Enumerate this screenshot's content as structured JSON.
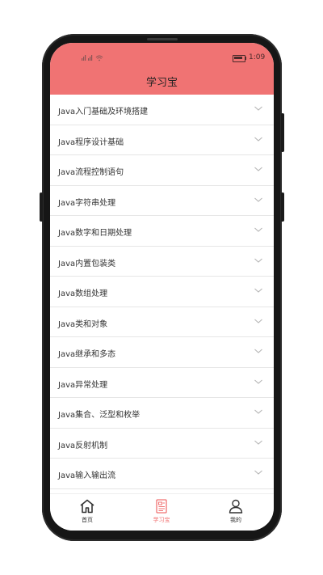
{
  "status_bar": {
    "signal_text": "ᵢᵢ ᵢᵢ",
    "time": "1:09"
  },
  "header": {
    "title": "学习宝",
    "background_color": "#f07373"
  },
  "list": {
    "items": [
      {
        "label": "Java入门基础及环境搭建"
      },
      {
        "label": "Java程序设计基础"
      },
      {
        "label": "Java流程控制语句"
      },
      {
        "label": "Java字符串处理"
      },
      {
        "label": "Java数字和日期处理"
      },
      {
        "label": "Java内置包装类"
      },
      {
        "label": "Java数组处理"
      },
      {
        "label": "Java类和对象"
      },
      {
        "label": "Java继承和多态"
      },
      {
        "label": "Java异常处理"
      },
      {
        "label": "Java集合、泛型和枚举"
      },
      {
        "label": "Java反射机制"
      },
      {
        "label": "Java输入输出流"
      }
    ]
  },
  "tabbar": {
    "tabs": [
      {
        "label": "首页",
        "icon": "home-icon",
        "active": false
      },
      {
        "label": "学习宝",
        "icon": "document-icon",
        "active": true
      },
      {
        "label": "我的",
        "icon": "user-icon",
        "active": false
      }
    ],
    "active_color": "#f07373"
  }
}
